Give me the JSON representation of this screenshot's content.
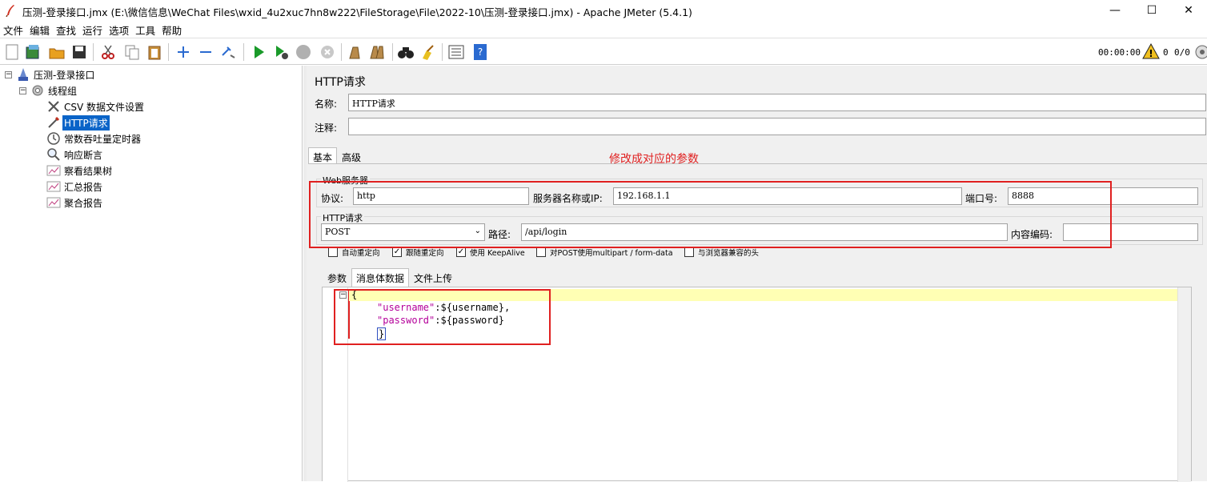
{
  "window": {
    "title": "压测-登录接口.jmx (E:\\微信信息\\WeChat Files\\wxid_4u2xuc7hn8w222\\FileStorage\\File\\2022-10\\压测-登录接口.jmx) - Apache JMeter (5.4.1)",
    "minimize": "—",
    "maximize": "☐",
    "close": "✕"
  },
  "menu": [
    "文件",
    "编辑",
    "查找",
    "运行",
    "选项",
    "工具",
    "帮助"
  ],
  "toolbar": {
    "timer": "00:00:00",
    "warn_count": "0",
    "threads": "0/0"
  },
  "tree": {
    "root": "压测-登录接口",
    "thread_group": "线程组",
    "children": [
      "CSV 数据文件设置",
      "HTTP请求",
      "常数吞吐量定时器",
      "响应断言",
      "察看结果树",
      "汇总报告",
      "聚合报告"
    ]
  },
  "panel": {
    "title": "HTTP请求",
    "name_label": "名称:",
    "name_value": "HTTP请求",
    "comment_label": "注释:",
    "comment_value": "",
    "tab_basic": "基本",
    "tab_advanced": "高级",
    "annotation": "修改成对应的参数",
    "web_server_group": "Web服务器",
    "protocol_label": "协议:",
    "protocol_value": "http",
    "server_label": "服务器名称或IP:",
    "server_value": "192.168.1.1",
    "port_label": "端口号:",
    "port_value": "8888",
    "http_request_group": "HTTP请求",
    "method_value": "POST",
    "path_label": "路径:",
    "path_value": "/api/login",
    "encoding_label": "内容编码:",
    "encoding_value": "",
    "checkboxes": [
      {
        "label": "自动重定向",
        "checked": false
      },
      {
        "label": "跟随重定向",
        "checked": true
      },
      {
        "label": "使用 KeepAlive",
        "checked": true
      },
      {
        "label": "对POST使用multipart / form-data",
        "checked": false
      },
      {
        "label": "与浏览器兼容的头",
        "checked": false
      }
    ],
    "subtabs": [
      "参数",
      "消息体数据",
      "文件上传"
    ],
    "body": {
      "line1": "{",
      "key1": "\"username\"",
      "val1": ":${username},",
      "key2": "\"password\"",
      "val2": ":${password}",
      "line4": "}"
    }
  },
  "colors": {
    "annotation": "#e02020",
    "selection": "#0a64c8",
    "json_key": "#b4009a"
  }
}
